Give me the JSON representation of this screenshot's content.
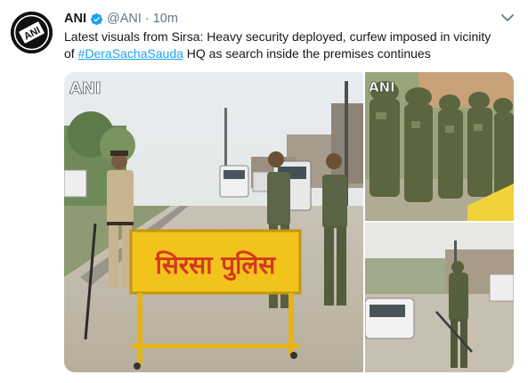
{
  "tweet": {
    "author_name": "ANI",
    "author_handle": "@ANI",
    "separator": "·",
    "time": "10m",
    "avatar_text": "ANI",
    "text_line1": "Latest visuals from Sirsa: Heavy security deployed, curfew imposed in vicinity",
    "text_prefix": "of ",
    "hashtag": "#DeraSachaSauda",
    "text_suffix": " HQ as search inside the premises continues"
  },
  "media": {
    "photos": [
      {
        "watermark": "ANI",
        "barricade_text": "सिरसा पुलिस"
      },
      {
        "watermark": "ANI"
      },
      {
        "watermark": ""
      }
    ]
  },
  "colors": {
    "link": "#1da1f2",
    "verified": "#1da1f2",
    "secondary_text": "#657786",
    "barricade_yellow": "#f2c31b",
    "barricade_text": "#d4381f"
  }
}
